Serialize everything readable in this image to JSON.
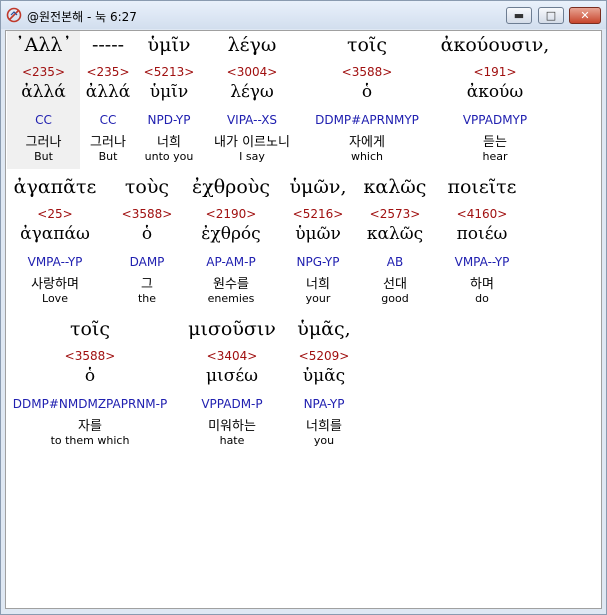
{
  "window": {
    "title": "@원전본해 - 눅 6:27",
    "icon": "bible-app-icon",
    "controls": {
      "minimize": "▬",
      "maximize": "□",
      "close": "✕"
    }
  },
  "rows": [
    {
      "words": [
        {
          "greek": "᾿Αλλ᾿",
          "strong": "<235>",
          "lemma": "ἀλλά",
          "parse": "CC",
          "korean": "그러나",
          "english": "But",
          "selected": true
        },
        {
          "greek": "-----",
          "strong": "<235>",
          "lemma": "ἀλλά",
          "parse": "CC",
          "korean": "그러나",
          "english": "But"
        },
        {
          "greek": "ὑμῖν",
          "strong": "<5213>",
          "lemma": "ὑμῖν",
          "parse": "NPD-YP",
          "korean": "너희",
          "english": "unto you"
        },
        {
          "greek": "λέγω",
          "strong": "<3004>",
          "lemma": "λέγω",
          "parse": "VIPA--XS",
          "korean": "내가 이르노니",
          "english": "I say"
        },
        {
          "greek": "τοῖς",
          "strong": "<3588>",
          "lemma": "ὁ",
          "parse": "DDMP#APRNMYP",
          "korean": "자에게",
          "english": "which"
        },
        {
          "greek": "ἀκούουσιν,",
          "strong": "<191>",
          "lemma": "ἀκούω",
          "parse": "VPPADMYP",
          "korean": "듣는",
          "english": "hear"
        }
      ]
    },
    {
      "words": [
        {
          "greek": "ἀγαπᾶτε",
          "strong": "<25>",
          "lemma": "ἀγαπάω",
          "parse": "VMPA--YP",
          "korean": "사랑하며",
          "english": "Love"
        },
        {
          "greek": "τοὺς",
          "strong": "<3588>",
          "lemma": "ὁ",
          "parse": "DAMP",
          "korean": "그",
          "english": "the"
        },
        {
          "greek": "ἐχθροὺς",
          "strong": "<2190>",
          "lemma": "ἐχθρός",
          "parse": "AP-AM-P",
          "korean": "원수를",
          "english": "enemies"
        },
        {
          "greek": "ὑμῶν,",
          "strong": "<5216>",
          "lemma": "ὑμῶν",
          "parse": "NPG-YP",
          "korean": "너희",
          "english": "your"
        },
        {
          "greek": "καλῶς",
          "strong": "<2573>",
          "lemma": "καλῶς",
          "parse": "AB",
          "korean": "선대",
          "english": "good"
        },
        {
          "greek": "ποιεῖτε",
          "strong": "<4160>",
          "lemma": "ποιέω",
          "parse": "VMPA--YP",
          "korean": "하며",
          "english": "do"
        }
      ]
    },
    {
      "words": [
        {
          "greek": "τοῖς",
          "strong": "<3588>",
          "lemma": "ὁ",
          "parse": "DDMP#NMDMZPAPRNM-P",
          "korean": "자를",
          "english": "to them which"
        },
        {
          "greek": "μισοῦσιν",
          "strong": "<3404>",
          "lemma": "μισέω",
          "parse": "VPPADM-P",
          "korean": "미워하는",
          "english": "hate"
        },
        {
          "greek": "ὑμᾶς,",
          "strong": "<5209>",
          "lemma": "ὑμᾶς",
          "parse": "NPA-YP",
          "korean": "너희를",
          "english": "you"
        }
      ]
    }
  ]
}
